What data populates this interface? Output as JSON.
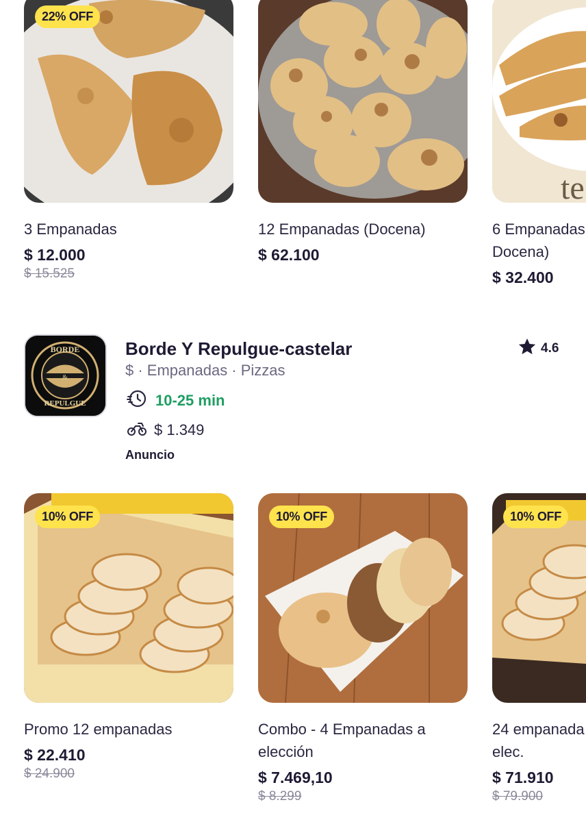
{
  "top_products": [
    {
      "name": "3 Empanadas",
      "price": "$ 12.000",
      "old_price": "$ 15.525",
      "badge": "22% OFF"
    },
    {
      "name": "12 Empanadas (Docena)",
      "price": "$ 62.100",
      "old_price": "",
      "badge": ""
    },
    {
      "name": "6 Empanadas",
      "name_line2": "Docena)",
      "price": "$ 32.400",
      "old_price": "",
      "badge": ""
    }
  ],
  "restaurant": {
    "name": "Borde Y Repulgue-castelar",
    "meta": "$ · Empanadas · Pizzas",
    "delivery_time": "10-25 min",
    "delivery_fee": "$ 1.349",
    "ad_label": "Anuncio",
    "rating": "4.6",
    "logo_text_top": "BORDE",
    "logo_text_amp": "&",
    "logo_text_bottom": "REPULGUE",
    "colors": {
      "time_green": "#1e9e62",
      "badge_yellow": "#ffe34d",
      "text_dark": "#1f1a33"
    }
  },
  "bottom_products": [
    {
      "name": "Promo 12 empanadas",
      "name_line2": "",
      "price": "$ 22.410",
      "old_price": "$ 24.900",
      "badge": "10% OFF"
    },
    {
      "name": "Combo - 4 Empanadas a",
      "name_line2": "elección",
      "price": "$ 7.469,10",
      "old_price": "$ 8.299",
      "badge": "10% OFF"
    },
    {
      "name": "24 empanada",
      "name_line2": "elec.",
      "price": "$ 71.910",
      "old_price": "$ 79.900",
      "badge": "10% OFF"
    }
  ]
}
